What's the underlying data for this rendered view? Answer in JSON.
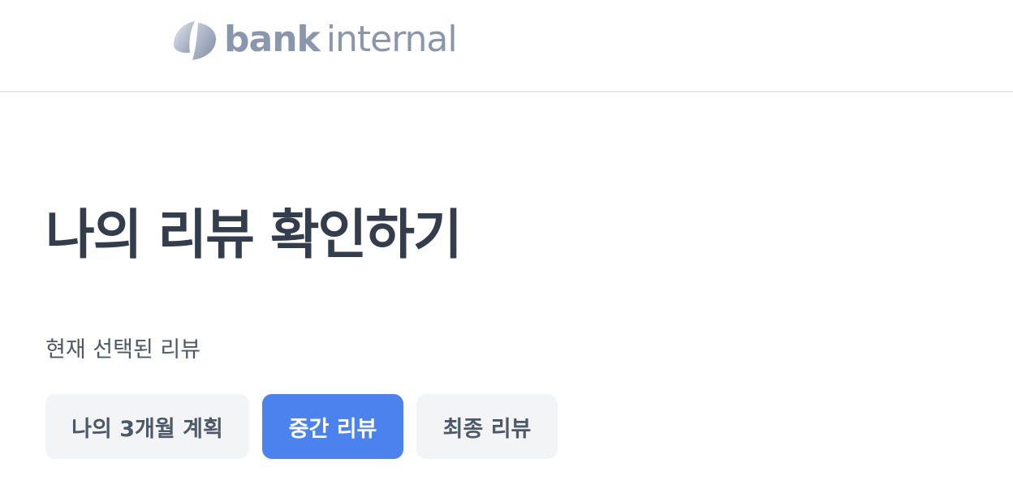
{
  "header": {
    "logo_icon": "bank-internal-logo-icon",
    "logo_bold": "bank",
    "logo_light": "internal"
  },
  "main": {
    "title": "나의 리뷰 확인하기",
    "selected_label": "현재 선택된 리뷰",
    "review_buttons": [
      {
        "label": "나의 3개월 계획",
        "active": false
      },
      {
        "label": "중간 리뷰",
        "active": true
      },
      {
        "label": "최종 리뷰",
        "active": false
      }
    ]
  },
  "colors": {
    "accent": "#4c82ee",
    "title": "#333d4b",
    "muted_text": "#4e5968",
    "button_bg": "#f2f4f6",
    "logo": "#8a96ad",
    "divider": "#e5e8eb"
  }
}
